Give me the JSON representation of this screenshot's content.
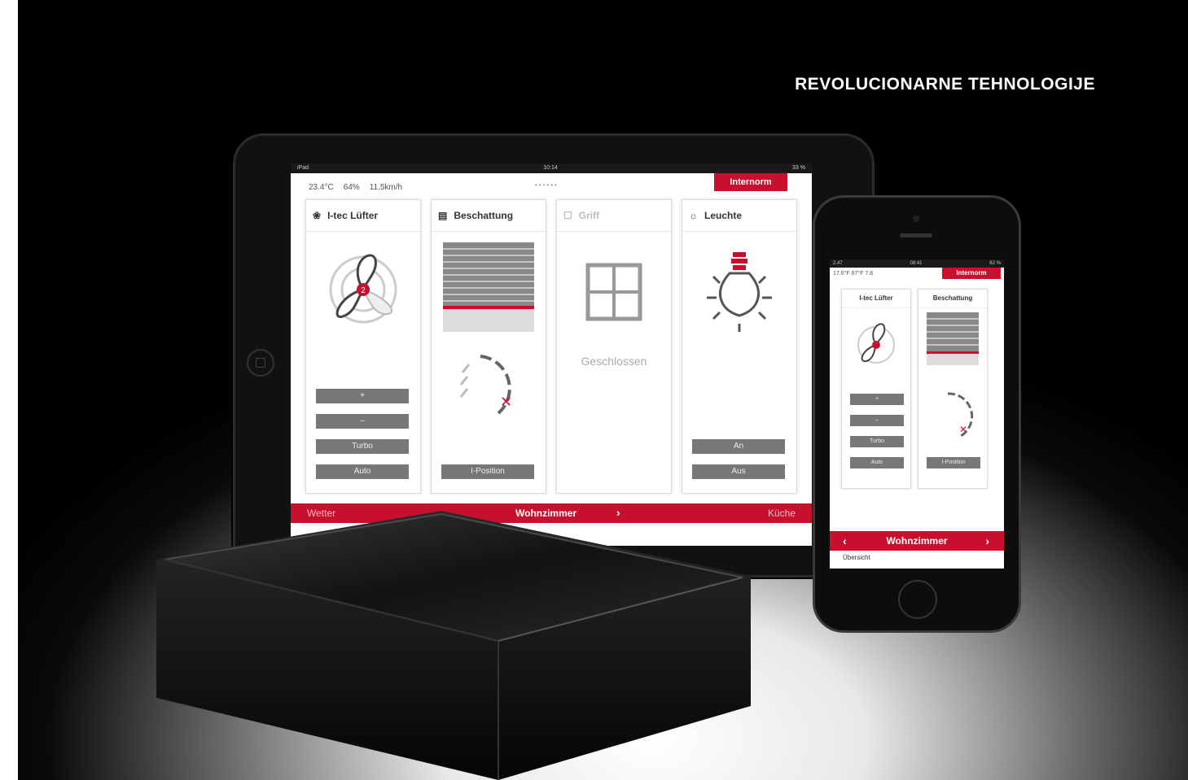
{
  "headline": "REVOLUCIONARNE TEHNOLOGIJE",
  "colors": {
    "brand_red": "#c8102e",
    "button_gray": "#777777"
  },
  "tablet": {
    "statusbar": {
      "left": "iPad",
      "center": "10:14",
      "right": "33 %"
    },
    "weather": {
      "temperature": "23.4°C",
      "humidity": "64%",
      "wind": "11.5km/h"
    },
    "brand": "Internorm",
    "cards": [
      {
        "title": "I-tec Lüfter",
        "icon": "fan-icon",
        "buttons": [
          "+",
          "–",
          "Turbo",
          "Auto"
        ]
      },
      {
        "title": "Beschattung",
        "icon": "blind-icon",
        "buttons": [
          "I-Position"
        ]
      },
      {
        "title": "Griff",
        "icon": "window-icon",
        "status": "Geschlossen",
        "buttons": []
      },
      {
        "title": "Leuchte",
        "icon": "lamp-icon",
        "buttons": [
          "An",
          "Aus"
        ]
      }
    ],
    "bottom": {
      "left": "Wetter",
      "room": "Wohnzimmer",
      "right": "Küche"
    }
  },
  "phone": {
    "statusbar": {
      "left": "2.47",
      "center": "08:41",
      "right": "82 %"
    },
    "weather": "17.6°F  67°F  7.8",
    "brand": "Internorm",
    "cards": [
      {
        "title": "I-tec Lüfter",
        "buttons": [
          "+",
          "–",
          "Turbo",
          "Auto"
        ]
      },
      {
        "title": "Beschattung",
        "buttons": [
          "I-Position"
        ]
      }
    ],
    "room": "Wohnzimmer",
    "overview": "Übersicht"
  }
}
